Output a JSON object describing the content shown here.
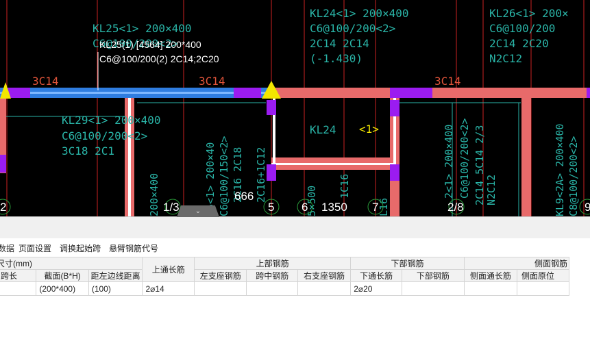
{
  "drawing": {
    "beam_labels": [
      {
        "line1": "KL25<1> 200×400",
        "line2": "C6@100/200<2>"
      },
      {
        "line1": "KL24<1> 200×400",
        "line2": "C6@100/200<2>",
        "line3": "2C14 2C14",
        "line4": "(-1.430)"
      },
      {
        "line1": "KL26<1> 200×",
        "line2": "C6@100/200",
        "line3": "2C14 2C20",
        "line4": "N2C12"
      },
      {
        "line1": "KL29<1> 200×400",
        "line2": "C6@100/200<2>",
        "line3": "3C18 2C1"
      }
    ],
    "tooltip": {
      "line1": "KL25(1) [4564] 200*400",
      "line2": "C6@100/200(2) 2C14;2C20"
    },
    "support_rebar": [
      "3C14",
      "3C14",
      "3C14"
    ],
    "kl24_tag": "KL24",
    "kl24_tag_suffix": "<1>",
    "vertical_labels": [
      "200×400",
      "L5<1> 200×40",
      "C6@100/150<2>",
      "2C16 2C18",
      "2C16+1C12",
      "5×500",
      "1C16",
      "L16",
      "2<1> 200×400",
      "C6@100/200<2>",
      "2C14 5C14 2/3",
      "N2C12",
      "KL9<2A> 200×400",
      "C8@100/200<2>"
    ],
    "numbers": [
      "666",
      "1350"
    ],
    "axis_marks": [
      "2",
      "1/3",
      "5",
      "6",
      "7",
      "2/8",
      "9"
    ]
  },
  "toolbar": {
    "items": [
      "数据",
      "页面设置",
      "调换起始跨",
      "悬臂钢筋代号"
    ]
  },
  "table": {
    "group_headers": {
      "size": "尺寸(mm)",
      "top_through": "上通长筋",
      "top_rebar": "上部钢筋",
      "bottom_rebar": "下部钢筋",
      "side_rebar": "侧面钢筋"
    },
    "sub_headers": {
      "span_length": "跨长",
      "section": "截面(B*H)",
      "left_offset": "距左边线距离",
      "left_support": "左支座钢筋",
      "mid_span": "跨中钢筋",
      "right_support": "右支座钢筋",
      "bottom_through": "下通长筋",
      "bottom": "下部钢筋",
      "side_through": "侧面通长筋",
      "side_origin": "侧面原位"
    },
    "row": {
      "span_length": "",
      "section": "(200*400)",
      "left_offset": "(100)",
      "top_through": "2⌀14",
      "left_support": "",
      "mid_span": "",
      "right_support": "",
      "bottom_through": "2⌀20",
      "bottom": "",
      "side_through": "",
      "side_origin": ""
    }
  },
  "colors": {
    "beam_pink": "#e86a6a",
    "beam_selected": "#2f7de0",
    "support_purple": "#9b1cf0",
    "grid_red": "#cc2222",
    "text_teal": "#2ab5a8",
    "marker_yellow": "#f2e600"
  }
}
